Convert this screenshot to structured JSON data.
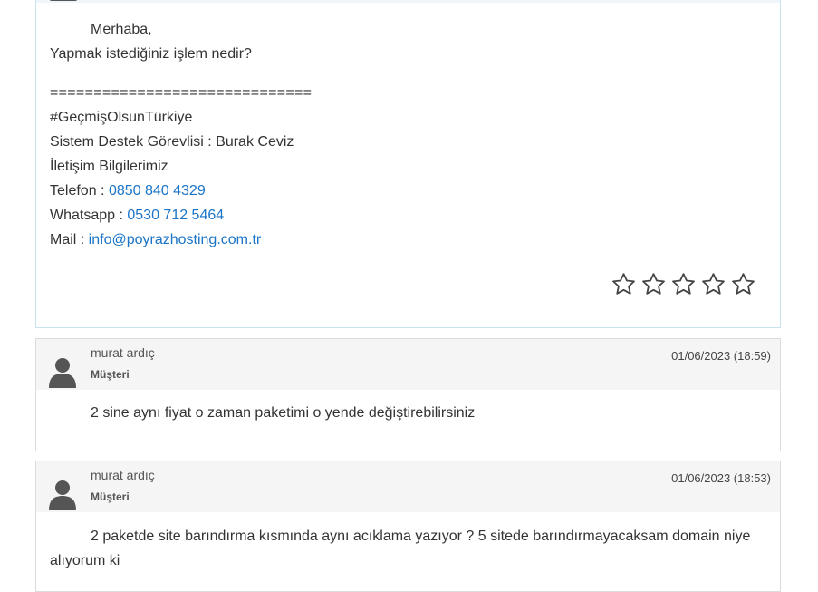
{
  "staff_reply": {
    "greeting": "Merhaba,",
    "question": "Yapmak istediğiniz işlem nedir?",
    "separator": "==============================",
    "hashtag": "#GeçmişOlsunTürkiye",
    "agent_line": "Sistem Destek Görevlisi : Burak Ceviz",
    "contact_heading": "İletişim Bilgilerimiz",
    "phone_label": "Telefon : ",
    "phone_value": "0850 840 4329",
    "whatsapp_label": "Whatsapp : ",
    "whatsapp_value": "0530 712 5464",
    "mail_label": "Mail : ",
    "mail_value": "info@poyrazhosting.com.tr",
    "rating": {
      "filled": 0,
      "max": 5,
      "icon": "star-outline-icon"
    }
  },
  "replies": [
    {
      "name": "murat ardıç",
      "role": "Müşteri",
      "date": "01/06/2023 (18:59)",
      "lines": [
        "2 sine aynı fiyat o zaman paketimi o yende değiştirebilirsiniz"
      ]
    },
    {
      "name": "murat ardıç",
      "role": "Müşteri",
      "date": "01/06/2023 (18:53)",
      "lines": [
        "2 paketde site barındırma kısmında aynı acıklama yazıyor ? 5 sitede barındırmayacaksam domain niye",
        "alıyorum ki"
      ]
    }
  ],
  "colors": {
    "link": "#1a74c7",
    "header_bg": "#f5f5f5",
    "staff_border": "#c9e3ee",
    "icon": "#555555"
  }
}
